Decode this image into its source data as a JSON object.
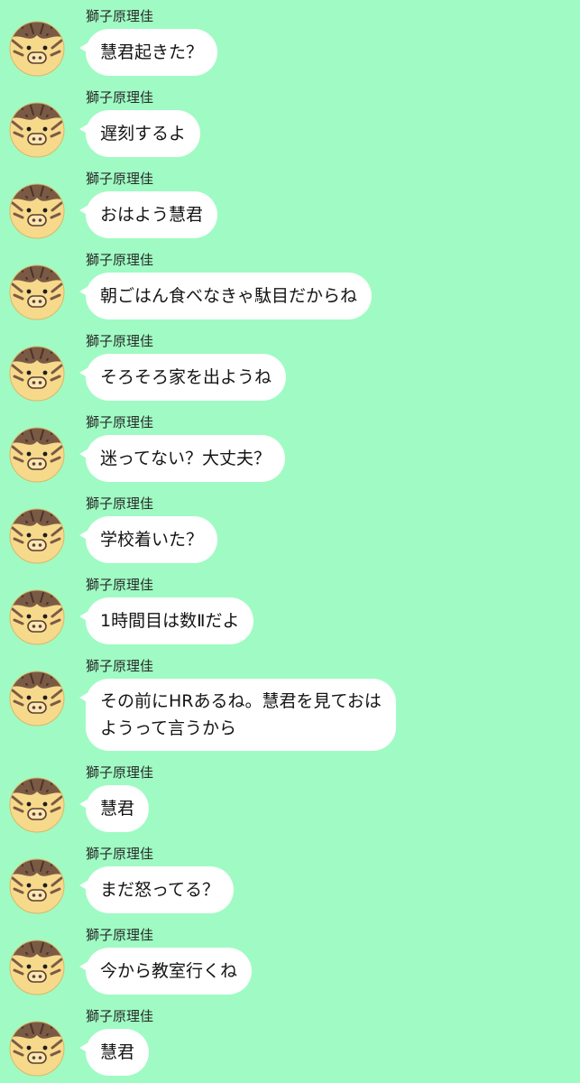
{
  "chat": {
    "sender_name": "獅子原理佳",
    "avatar_icon": "boar-avatar-icon",
    "colors": {
      "background": "#9ffbc3",
      "bubble": "#ffffff",
      "avatar_face": "#f7d98b",
      "avatar_stripes": "#7a5a45"
    },
    "messages": [
      {
        "text": "慧君起きた？"
      },
      {
        "text": "遅刻するよ"
      },
      {
        "text": "おはよう慧君"
      },
      {
        "text": "朝ごはん食べなきゃ駄目だからね"
      },
      {
        "text": "そろそろ家を出ようね"
      },
      {
        "text": "迷ってない？大丈夫？"
      },
      {
        "text": "学校着いた？"
      },
      {
        "text": "1時間目は数Ⅱだよ"
      },
      {
        "text": "その前にHRあるね。慧君を見ておは\nようって言うから"
      },
      {
        "text": "慧君"
      },
      {
        "text": "まだ怒ってる？"
      },
      {
        "text": "今から教室行くね"
      },
      {
        "text": "慧君"
      }
    ]
  }
}
